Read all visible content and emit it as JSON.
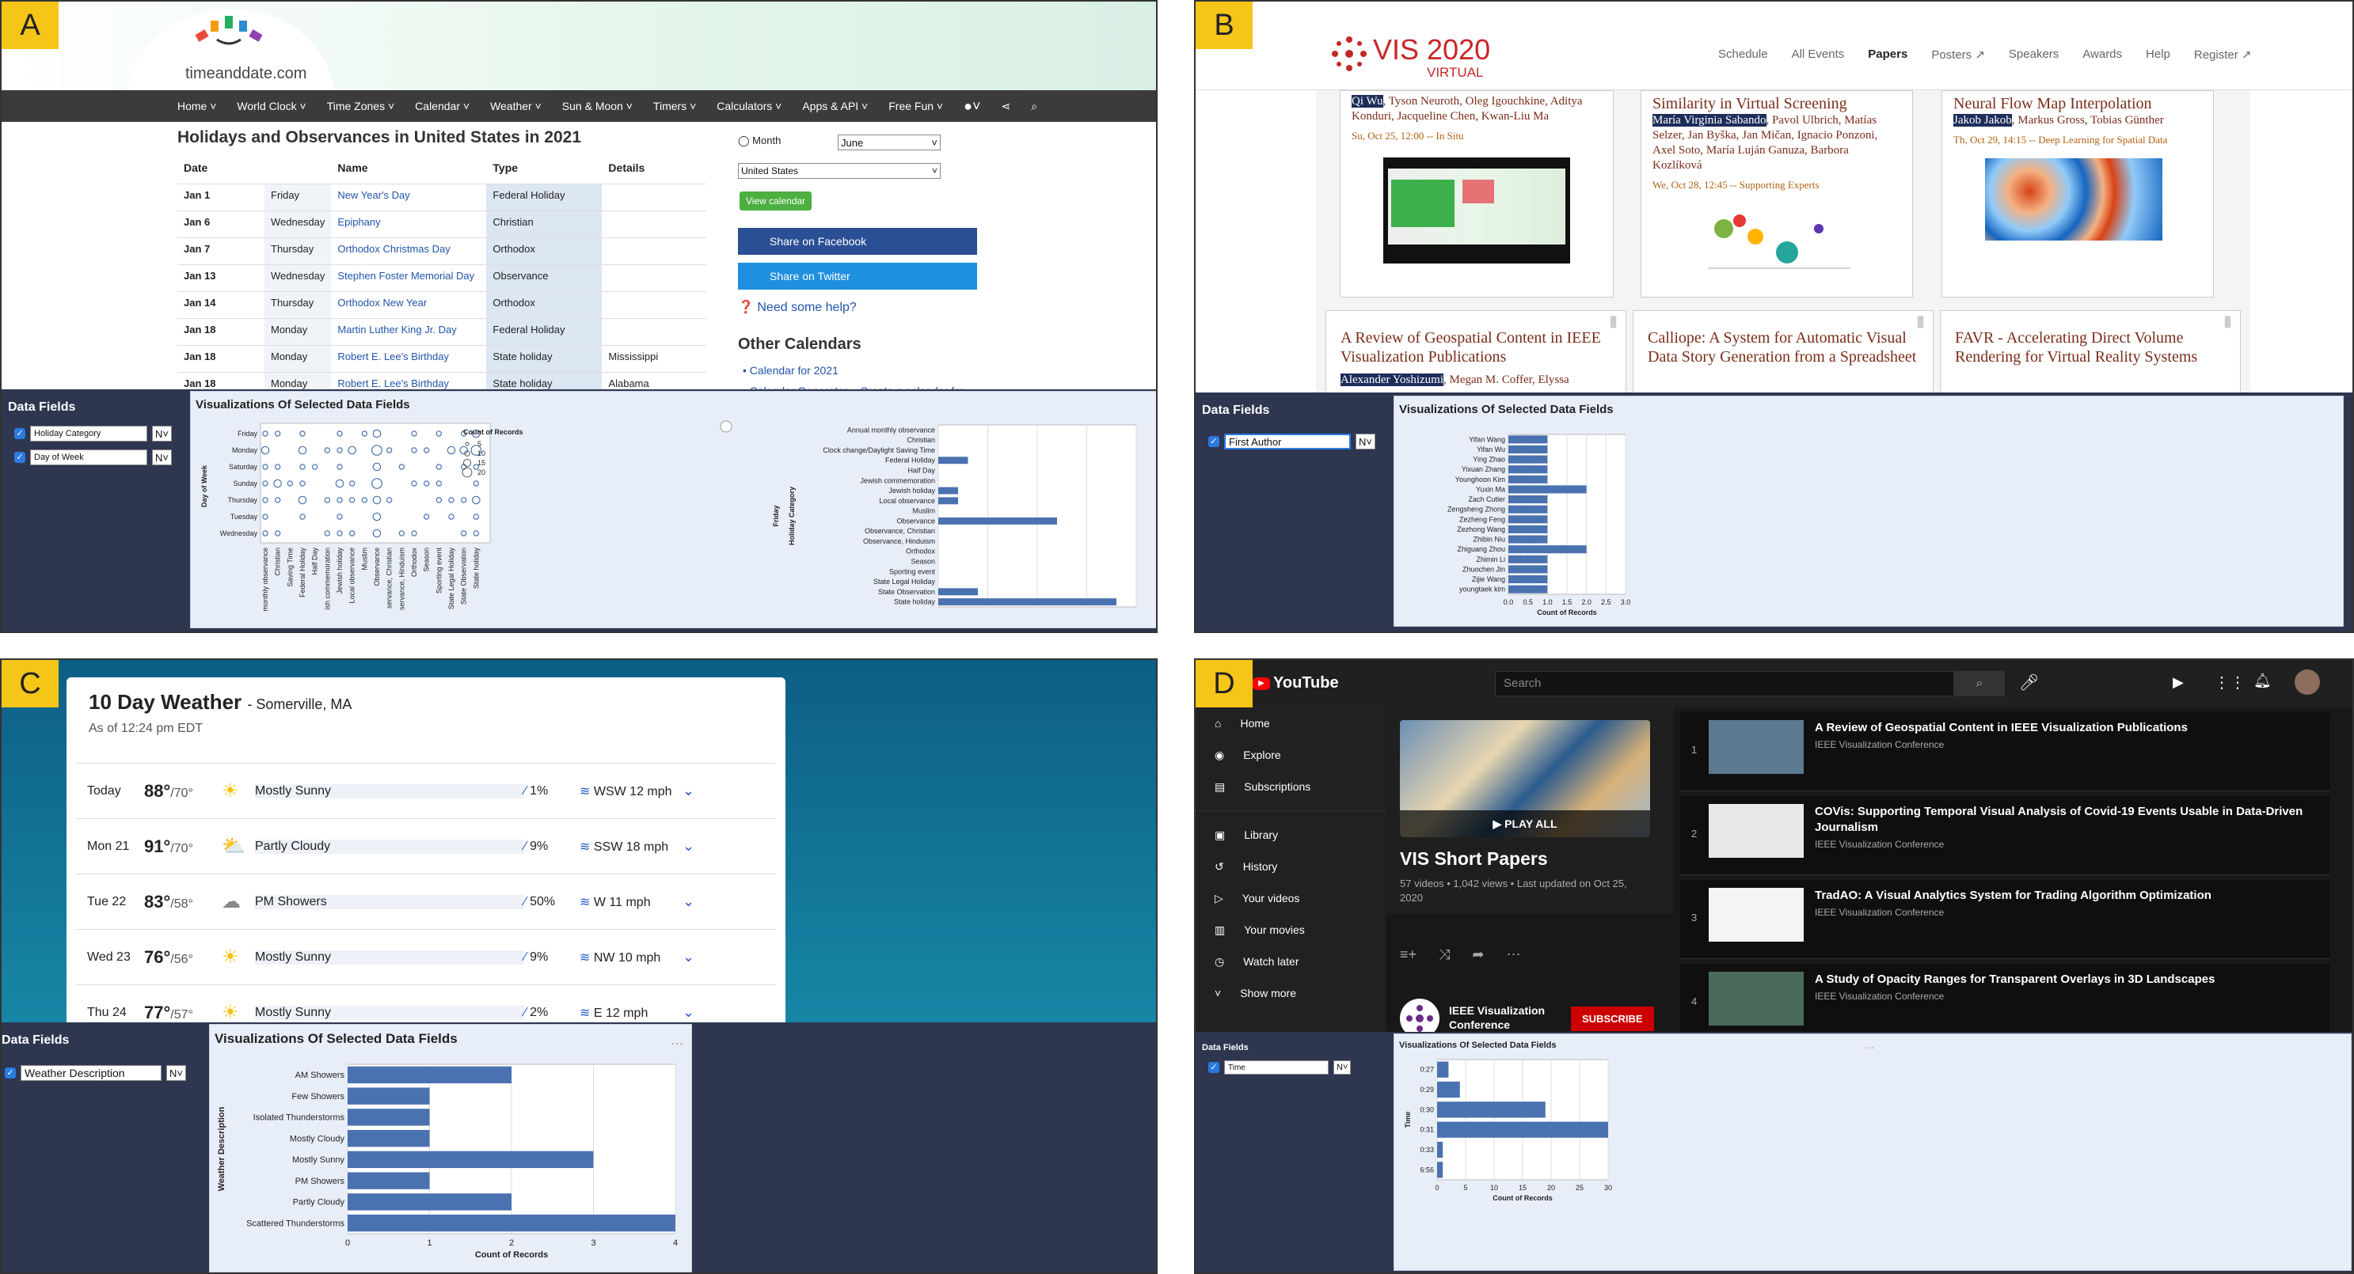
{
  "labels": {
    "a": "A",
    "b": "B",
    "c": "C",
    "d": "D"
  },
  "vx": {
    "data_fields": "Data Fields",
    "viz_title": "Visualizations Of Selected Data Fields",
    "n": "N"
  },
  "a": {
    "logo": "timeanddate.com",
    "nav": [
      "Home ˅",
      "World Clock ˅",
      "Time Zones ˅",
      "Calendar ˅",
      "Weather ˅",
      "Sun & Moon ˅",
      "Timers ˅",
      "Calculators ˅",
      "Apps & API ˅",
      "Free Fun ˅"
    ],
    "title": "Holidays and Observances in United States in 2021",
    "cols": [
      "Date",
      "Name",
      "Type",
      "Details"
    ],
    "rows": [
      [
        "Jan 1",
        "Friday",
        "New Year's Day",
        "Federal Holiday",
        ""
      ],
      [
        "Jan 6",
        "Wednesday",
        "Epiphany",
        "Christian",
        ""
      ],
      [
        "Jan 7",
        "Thursday",
        "Orthodox Christmas Day",
        "Orthodox",
        ""
      ],
      [
        "Jan 13",
        "Wednesday",
        "Stephen Foster Memorial Day",
        "Observance",
        ""
      ],
      [
        "Jan 14",
        "Thursday",
        "Orthodox New Year",
        "Orthodox",
        ""
      ],
      [
        "Jan 18",
        "Monday",
        "Martin Luther King Jr. Day",
        "Federal Holiday",
        ""
      ],
      [
        "Jan 18",
        "Monday",
        "Robert E. Lee's Birthday",
        "State holiday",
        "Mississippi"
      ],
      [
        "Jan 18",
        "Monday",
        "Robert E. Lee's Birthday",
        "State holiday",
        "Alabama"
      ]
    ],
    "month_label": "Month",
    "month_val": "June",
    "country": "United States",
    "view_btn": "View calendar",
    "share_fb": "Share on Facebook",
    "share_tw": "Share on Twitter",
    "help": "Need some help?",
    "other": "Other Calendars",
    "cal_link": "Calendar for 2021",
    "cal_link2": "Calendar Generator – Create a calendar for",
    "fields": [
      "Holiday Category",
      "Day of Week"
    ],
    "legend_title": "Count of Records",
    "legend_vals": [
      "5",
      "10",
      "15",
      "20"
    ],
    "dot_y": [
      "Friday",
      "Monday",
      "Saturday",
      "Sunday",
      "Thursday",
      "Tuesday",
      "Wednesday"
    ],
    "dot_y_title": "Day of Week",
    "dot_x": [
      "Annual monthly observance",
      "Christian",
      "Clock change/Daylight Saving Time",
      "Federal Holiday",
      "Half Day",
      "Jewish commemoration",
      "Jewish holiday",
      "Local observance",
      "Muslim",
      "Observance",
      "Observance, Christian",
      "Observance, Hinduism",
      "Orthodox",
      "Season",
      "Sporting event",
      "State Legal Holiday",
      "State Observation",
      "State holiday"
    ],
    "dot_x_short": [
      "monthly observance",
      "Christian",
      "Saving Time",
      "Federal Holiday",
      "Half Day",
      "ish commemoration",
      "Jewish holiday",
      "Local observance",
      "Muslim",
      "Observance",
      "servance, Christian",
      "servance, Hinduism",
      "Orthodox",
      "Season",
      "Sporting event",
      "State Legal Holiday",
      "State Observation",
      "State holiday"
    ],
    "bar_y_title": "Holiday Category",
    "bar_facet": "Friday"
  },
  "b": {
    "brand": "VIS 2020",
    "brand_sub": "VIRTUAL",
    "menu": [
      "Schedule",
      "All Events",
      "Papers",
      "Posters ↗",
      "Speakers",
      "Awards",
      "Help",
      "Register ↗"
    ],
    "cards_top": [
      {
        "title": "",
        "authors_hl": "Qi Wu",
        "authors": ", Tyson Neuroth, Oleg Igouchkine, Aditya Konduri, Jacqueline Chen, Kwan-Liu Ma",
        "meta": "Su, Oct 25, 12:00 -- In Situ"
      },
      {
        "title": "Similarity in Virtual Screening",
        "authors_hl": "María Virginia Sabando",
        "authors": ", Pavol Ulbrich, Matías Selzer, Jan Byška, Jan Mičan, Ignacio Ponzoni, Axel Soto, María Luján Ganuza, Barbora Kozlíková",
        "meta": "We, Oct 28, 12:45 -- Supporting Experts"
      },
      {
        "title": "Neural Flow Map Interpolation",
        "authors_hl": "Jakob Jakob",
        "authors": ", Markus Gross, Tobias Günther",
        "meta": "Th, Oct 29, 14:15 -- Deep Learning for Spatial Data"
      }
    ],
    "cards_bot": [
      {
        "title": "A Review of Geospatial Content in IEEE Visualization Publications",
        "authors_hl": "Alexander Yoshizumi",
        "authors": ", Megan M. Coffer, Elyssa"
      },
      {
        "title": "Calliope: A System for Automatic Visual Data Story Generation from a Spreadsheet",
        "authors_hl": "",
        "authors": ""
      },
      {
        "title": "FAVR - Accelerating Direct Volume Rendering for Virtual Reality Systems",
        "authors_hl": "",
        "authors": ""
      }
    ],
    "field": "First Author"
  },
  "c": {
    "title": "10 Day Weather",
    "loc": "- Somerville, MA",
    "asof": "As of 12:24 pm EDT",
    "rows": [
      [
        "Today",
        "88°",
        "/70°",
        "Mostly Sunny",
        "1%",
        "WSW 12 mph"
      ],
      [
        "Mon 21",
        "91°",
        "/70°",
        "Partly Cloudy",
        "9%",
        "SSW 18 mph"
      ],
      [
        "Tue 22",
        "83°",
        "/58°",
        "PM Showers",
        "50%",
        "W 11 mph"
      ],
      [
        "Wed 23",
        "76°",
        "/56°",
        "Mostly Sunny",
        "9%",
        "NW 10 mph"
      ],
      [
        "Thu 24",
        "77°",
        "/57°",
        "Mostly Sunny",
        "2%",
        "E 12 mph"
      ]
    ],
    "field": "Weather Description"
  },
  "d": {
    "logo": "YouTube",
    "search": "Search",
    "side": [
      "Home",
      "Explore",
      "Subscriptions",
      "Library",
      "History",
      "Your videos",
      "Your movies",
      "Watch later",
      "Show more"
    ],
    "play_all": "PLAY ALL",
    "pl_title": "VIS Short Papers",
    "pl_meta": "57 videos • 1,042 views • Last updated on Oct 25, 2020",
    "channel": "IEEE Visualization Conference",
    "subscribe": "SUBSCRIBE",
    "videos": [
      {
        "n": "1",
        "t": "A Review of Geospatial Content in IEEE Visualization Publications",
        "c": "IEEE Visualization Conference"
      },
      {
        "n": "2",
        "t": "COVis: Supporting Temporal Visual Analysis of Covid-19 Events Usable in Data-Driven Journalism",
        "c": "IEEE Visualization Conference"
      },
      {
        "n": "3",
        "t": "TradAO: A Visual Analytics System for Trading Algorithm Optimization",
        "c": "IEEE Visualization Conference"
      },
      {
        "n": "4",
        "t": "A Study of Opacity Ranges for Transparent Overlays in 3D Landscapes",
        "c": "IEEE Visualization Conference"
      }
    ],
    "field": "Time"
  },
  "chart_data": [
    {
      "type": "scatter",
      "title": "",
      "xlabel": "Holiday Category",
      "ylabel": "Day of Week",
      "size_legend": "Count of Records"
    },
    {
      "type": "bar",
      "orientation": "horizontal",
      "facet": "Friday",
      "ylabel": "Holiday Category",
      "categories": [
        "Annual monthly observance",
        "Christian",
        "Clock change/Daylight Saving Time",
        "Federal Holiday",
        "Half Day",
        "Jewish commemoration",
        "Jewish holiday",
        "Local observance",
        "Muslim",
        "Observance",
        "Observance, Christian",
        "Observance, Hinduism",
        "Orthodox",
        "Season",
        "Sporting event",
        "State Legal Holiday",
        "State Observation",
        "State holiday"
      ],
      "values": [
        0,
        0,
        0,
        3,
        0,
        0,
        2,
        2,
        0,
        12,
        0,
        0,
        0,
        0,
        0,
        0,
        4,
        18
      ]
    },
    {
      "type": "bar",
      "orientation": "horizontal",
      "xlabel": "Count of Records",
      "ylabel": "First Author",
      "categories": [
        "Yifan Wang",
        "Yifan Wu",
        "Ying Zhao",
        "Yixuan Zhang",
        "Younghoon Kim",
        "Yuxin Ma",
        "Zach Cutler",
        "Zengsheng Zhong",
        "Zezheng Feng",
        "Zezhong Wang",
        "Zhibin Niu",
        "Zhiguang Zhou",
        "Zhimin Li",
        "Zhuochen Jin",
        "Zijie Wang",
        "youngtaek kim"
      ],
      "values": [
        1,
        1,
        1,
        1,
        1,
        2,
        1,
        1,
        1,
        1,
        1,
        2,
        1,
        1,
        1,
        1
      ],
      "xticks": [
        "0.0",
        "0.5",
        "1.0",
        "1.5",
        "2.0",
        "2.5",
        "3.0"
      ],
      "xlim": [
        0,
        3
      ]
    },
    {
      "type": "bar",
      "orientation": "horizontal",
      "xlabel": "Count of Records",
      "ylabel": "Weather Description",
      "categories": [
        "AM Showers",
        "Few Showers",
        "Isolated Thunderstorms",
        "Mostly Cloudy",
        "Mostly Sunny",
        "PM Showers",
        "Partly Cloudy",
        "Scattered Thunderstorms"
      ],
      "values": [
        2,
        1,
        1,
        1,
        3,
        1,
        2,
        4
      ],
      "xticks": [
        "0",
        "1",
        "2",
        "3",
        "4"
      ],
      "xlim": [
        0,
        4
      ]
    },
    {
      "type": "bar",
      "orientation": "horizontal",
      "xlabel": "Count of Records",
      "ylabel": "Time",
      "categories": [
        "0:27",
        "0:29",
        "0:30",
        "0:31",
        "0:33",
        "6:56"
      ],
      "values": [
        2,
        4,
        19,
        30,
        1,
        1
      ],
      "xticks": [
        "0",
        "5",
        "10",
        "15",
        "20",
        "25",
        "30"
      ],
      "xlim": [
        0,
        30
      ]
    }
  ],
  "colors": {
    "bar": "#4a72b0",
    "vx_bg": "#2e3650",
    "label": "#f5c518"
  }
}
